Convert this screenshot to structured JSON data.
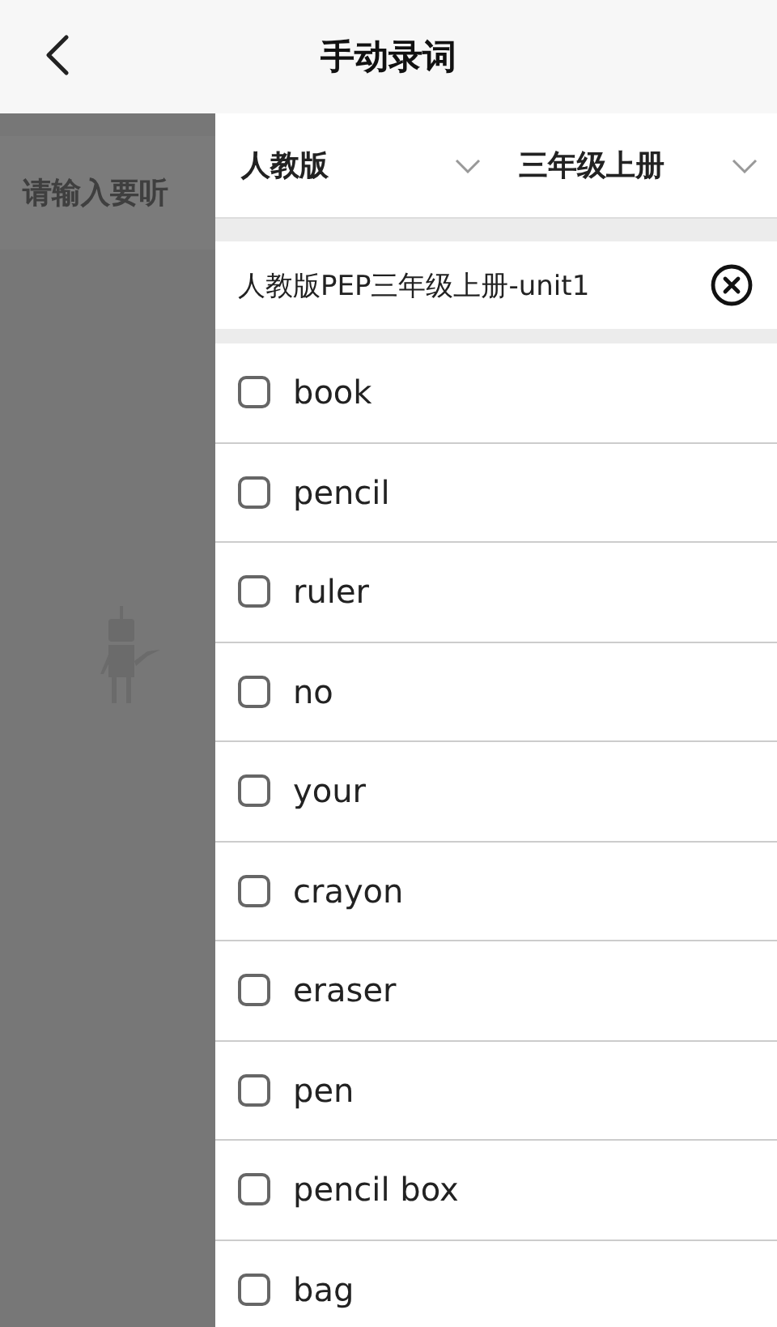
{
  "header": {
    "title": "手动录词"
  },
  "background": {
    "placeholder": "请输入要听"
  },
  "filters": [
    {
      "label": "人教版"
    },
    {
      "label": "三年级上册"
    }
  ],
  "unit": {
    "label": "人教版PEP三年级上册-unit1"
  },
  "words": [
    {
      "text": "book",
      "checked": false
    },
    {
      "text": "pencil",
      "checked": false
    },
    {
      "text": "ruler",
      "checked": false
    },
    {
      "text": "no",
      "checked": false
    },
    {
      "text": "your",
      "checked": false
    },
    {
      "text": "crayon",
      "checked": false
    },
    {
      "text": "eraser",
      "checked": false
    },
    {
      "text": "pen",
      "checked": false
    },
    {
      "text": "pencil box",
      "checked": false
    },
    {
      "text": "bag",
      "checked": false
    }
  ]
}
